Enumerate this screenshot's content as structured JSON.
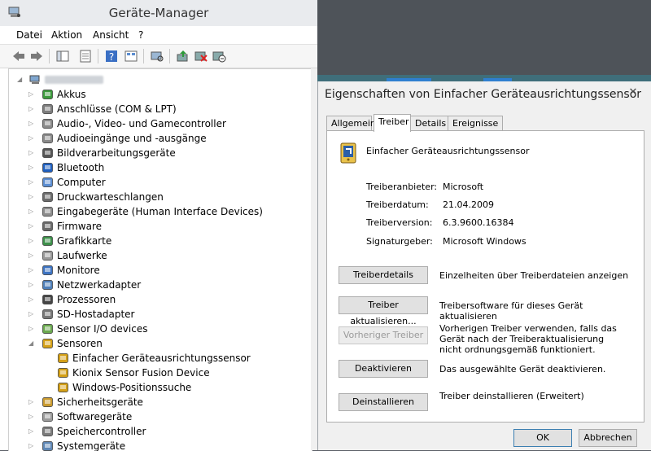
{
  "device_manager": {
    "title": "Geräte-Manager",
    "menu": [
      "Datei",
      "Aktion",
      "Ansicht",
      "?"
    ],
    "toolbar_icons": [
      "back-arrow-icon",
      "forward-arrow-icon",
      "show-hide-icon",
      "properties-icon",
      "help-icon",
      "view-icon",
      "scan-hardware-icon",
      "update-driver-icon",
      "uninstall-icon",
      "enable-icon"
    ],
    "tree": {
      "computer_name_hidden": "",
      "categories": [
        {
          "label": "Akkus",
          "icon": "battery-icon"
        },
        {
          "label": "Anschlüsse (COM & LPT)",
          "icon": "port-icon"
        },
        {
          "label": "Audio-, Video- und Gamecontroller",
          "icon": "speaker-icon"
        },
        {
          "label": "Audioeingänge und -ausgänge",
          "icon": "speaker-icon"
        },
        {
          "label": "Bildverarbeitungsgeräte",
          "icon": "camera-icon"
        },
        {
          "label": "Bluetooth",
          "icon": "bluetooth-icon"
        },
        {
          "label": "Computer",
          "icon": "computer-icon"
        },
        {
          "label": "Druckwarteschlangen",
          "icon": "printer-icon"
        },
        {
          "label": "Eingabegeräte (Human Interface Devices)",
          "icon": "hid-icon"
        },
        {
          "label": "Firmware",
          "icon": "firmware-icon"
        },
        {
          "label": "Grafikkarte",
          "icon": "display-adapter-icon"
        },
        {
          "label": "Laufwerke",
          "icon": "drive-icon"
        },
        {
          "label": "Monitore",
          "icon": "monitor-icon"
        },
        {
          "label": "Netzwerkadapter",
          "icon": "network-icon"
        },
        {
          "label": "Prozessoren",
          "icon": "processor-icon"
        },
        {
          "label": "SD-Hostadapter",
          "icon": "sd-icon"
        },
        {
          "label": "Sensor I/O devices",
          "icon": "sensor-io-icon"
        },
        {
          "label": "Sensoren",
          "icon": "sensor-icon"
        }
      ],
      "sensor_children": [
        "Einfacher Geräteausrichtungssensor",
        "Kionix Sensor Fusion Device",
        "Windows-Positionssuche"
      ],
      "categories_after": [
        {
          "label": "Sicherheitsgeräte",
          "icon": "security-icon"
        },
        {
          "label": "Softwaregeräte",
          "icon": "software-icon"
        },
        {
          "label": "Speichercontroller",
          "icon": "storage-icon"
        },
        {
          "label": "Systemgeräte",
          "icon": "system-icon"
        }
      ]
    }
  },
  "properties": {
    "title": "Eigenschaften von Einfacher Geräteausrichtungssensor",
    "close": "✕",
    "tabs": [
      "Allgemein",
      "Treiber",
      "Details",
      "Ereignisse"
    ],
    "active_tab": "Treiber",
    "device_name": "Einfacher Geräteausrichtungssensor",
    "info": [
      {
        "label": "Treiberanbieter:",
        "value": "Microsoft"
      },
      {
        "label": "Treiberdatum:",
        "value": "21.04.2009"
      },
      {
        "label": "Treiberversion:",
        "value": "6.3.9600.16384"
      },
      {
        "label": "Signaturgeber:",
        "value": "Microsoft Windows"
      }
    ],
    "actions": [
      {
        "button": "Treiberdetails",
        "desc": "Einzelheiten über Treiberdateien anzeigen",
        "enabled": true
      },
      {
        "button": "Treiber aktualisieren...",
        "desc": "Treibersoftware für dieses Gerät aktualisieren",
        "enabled": true
      },
      {
        "button": "Vorheriger Treiber",
        "desc": "Vorherigen Treiber verwenden, falls das Gerät nach der Treiberaktualisierung nicht ordnungsgemäß funktioniert.",
        "enabled": false
      },
      {
        "button": "Deaktivieren",
        "desc": "Das ausgewählte Gerät deaktivieren.",
        "enabled": true
      },
      {
        "button": "Deinstallieren",
        "desc": "Treiber deinstallieren (Erweitert)",
        "enabled": true
      }
    ],
    "ok": "OK",
    "cancel": "Abbrechen"
  }
}
